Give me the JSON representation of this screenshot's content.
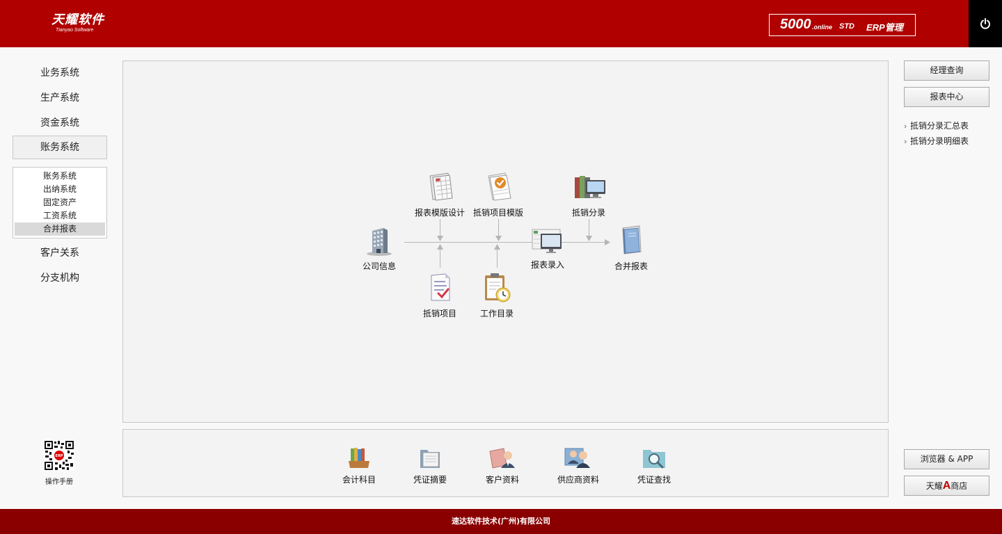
{
  "header": {
    "logo_cn": "天耀软件",
    "logo_en": "Tianyao Software",
    "product_num": "5000",
    "product_online": ".online",
    "product_std": "STD",
    "product_erp": "ERP管理",
    "brand_color": "#b00000"
  },
  "nav": {
    "items": [
      "业务系统",
      "生产系统",
      "资金系统",
      "账务系统",
      "客户关系",
      "分支机构"
    ],
    "active_index": 3,
    "submenu": [
      "账务系统",
      "出纳系统",
      "固定资产",
      "工资系统",
      "合并报表"
    ],
    "selected_sub_index": 4
  },
  "manual": {
    "label": "操作手册"
  },
  "flow": {
    "company_info": "公司信息",
    "template_design": "报表模版设计",
    "offset_template": "抵销项目模版",
    "offset_entry": "抵销分录",
    "report_entry": "报表录入",
    "consolidated": "合并报表",
    "offset_items": "抵销项目",
    "work_directory": "工作目录"
  },
  "shortcuts": [
    "会计科目",
    "凭证摘要",
    "客户资料",
    "供应商资料",
    "凭证查找"
  ],
  "right": {
    "manager_query": "经理查询",
    "report_center": "报表中心",
    "links": [
      "抵销分录汇总表",
      "抵销分录明细表"
    ],
    "browser_app": "浏览器 & APP",
    "store_prefix": "天耀",
    "store_a": "A",
    "store_suffix": "商店"
  },
  "footer": {
    "company": "速达软件技术(广州)有限公司"
  }
}
